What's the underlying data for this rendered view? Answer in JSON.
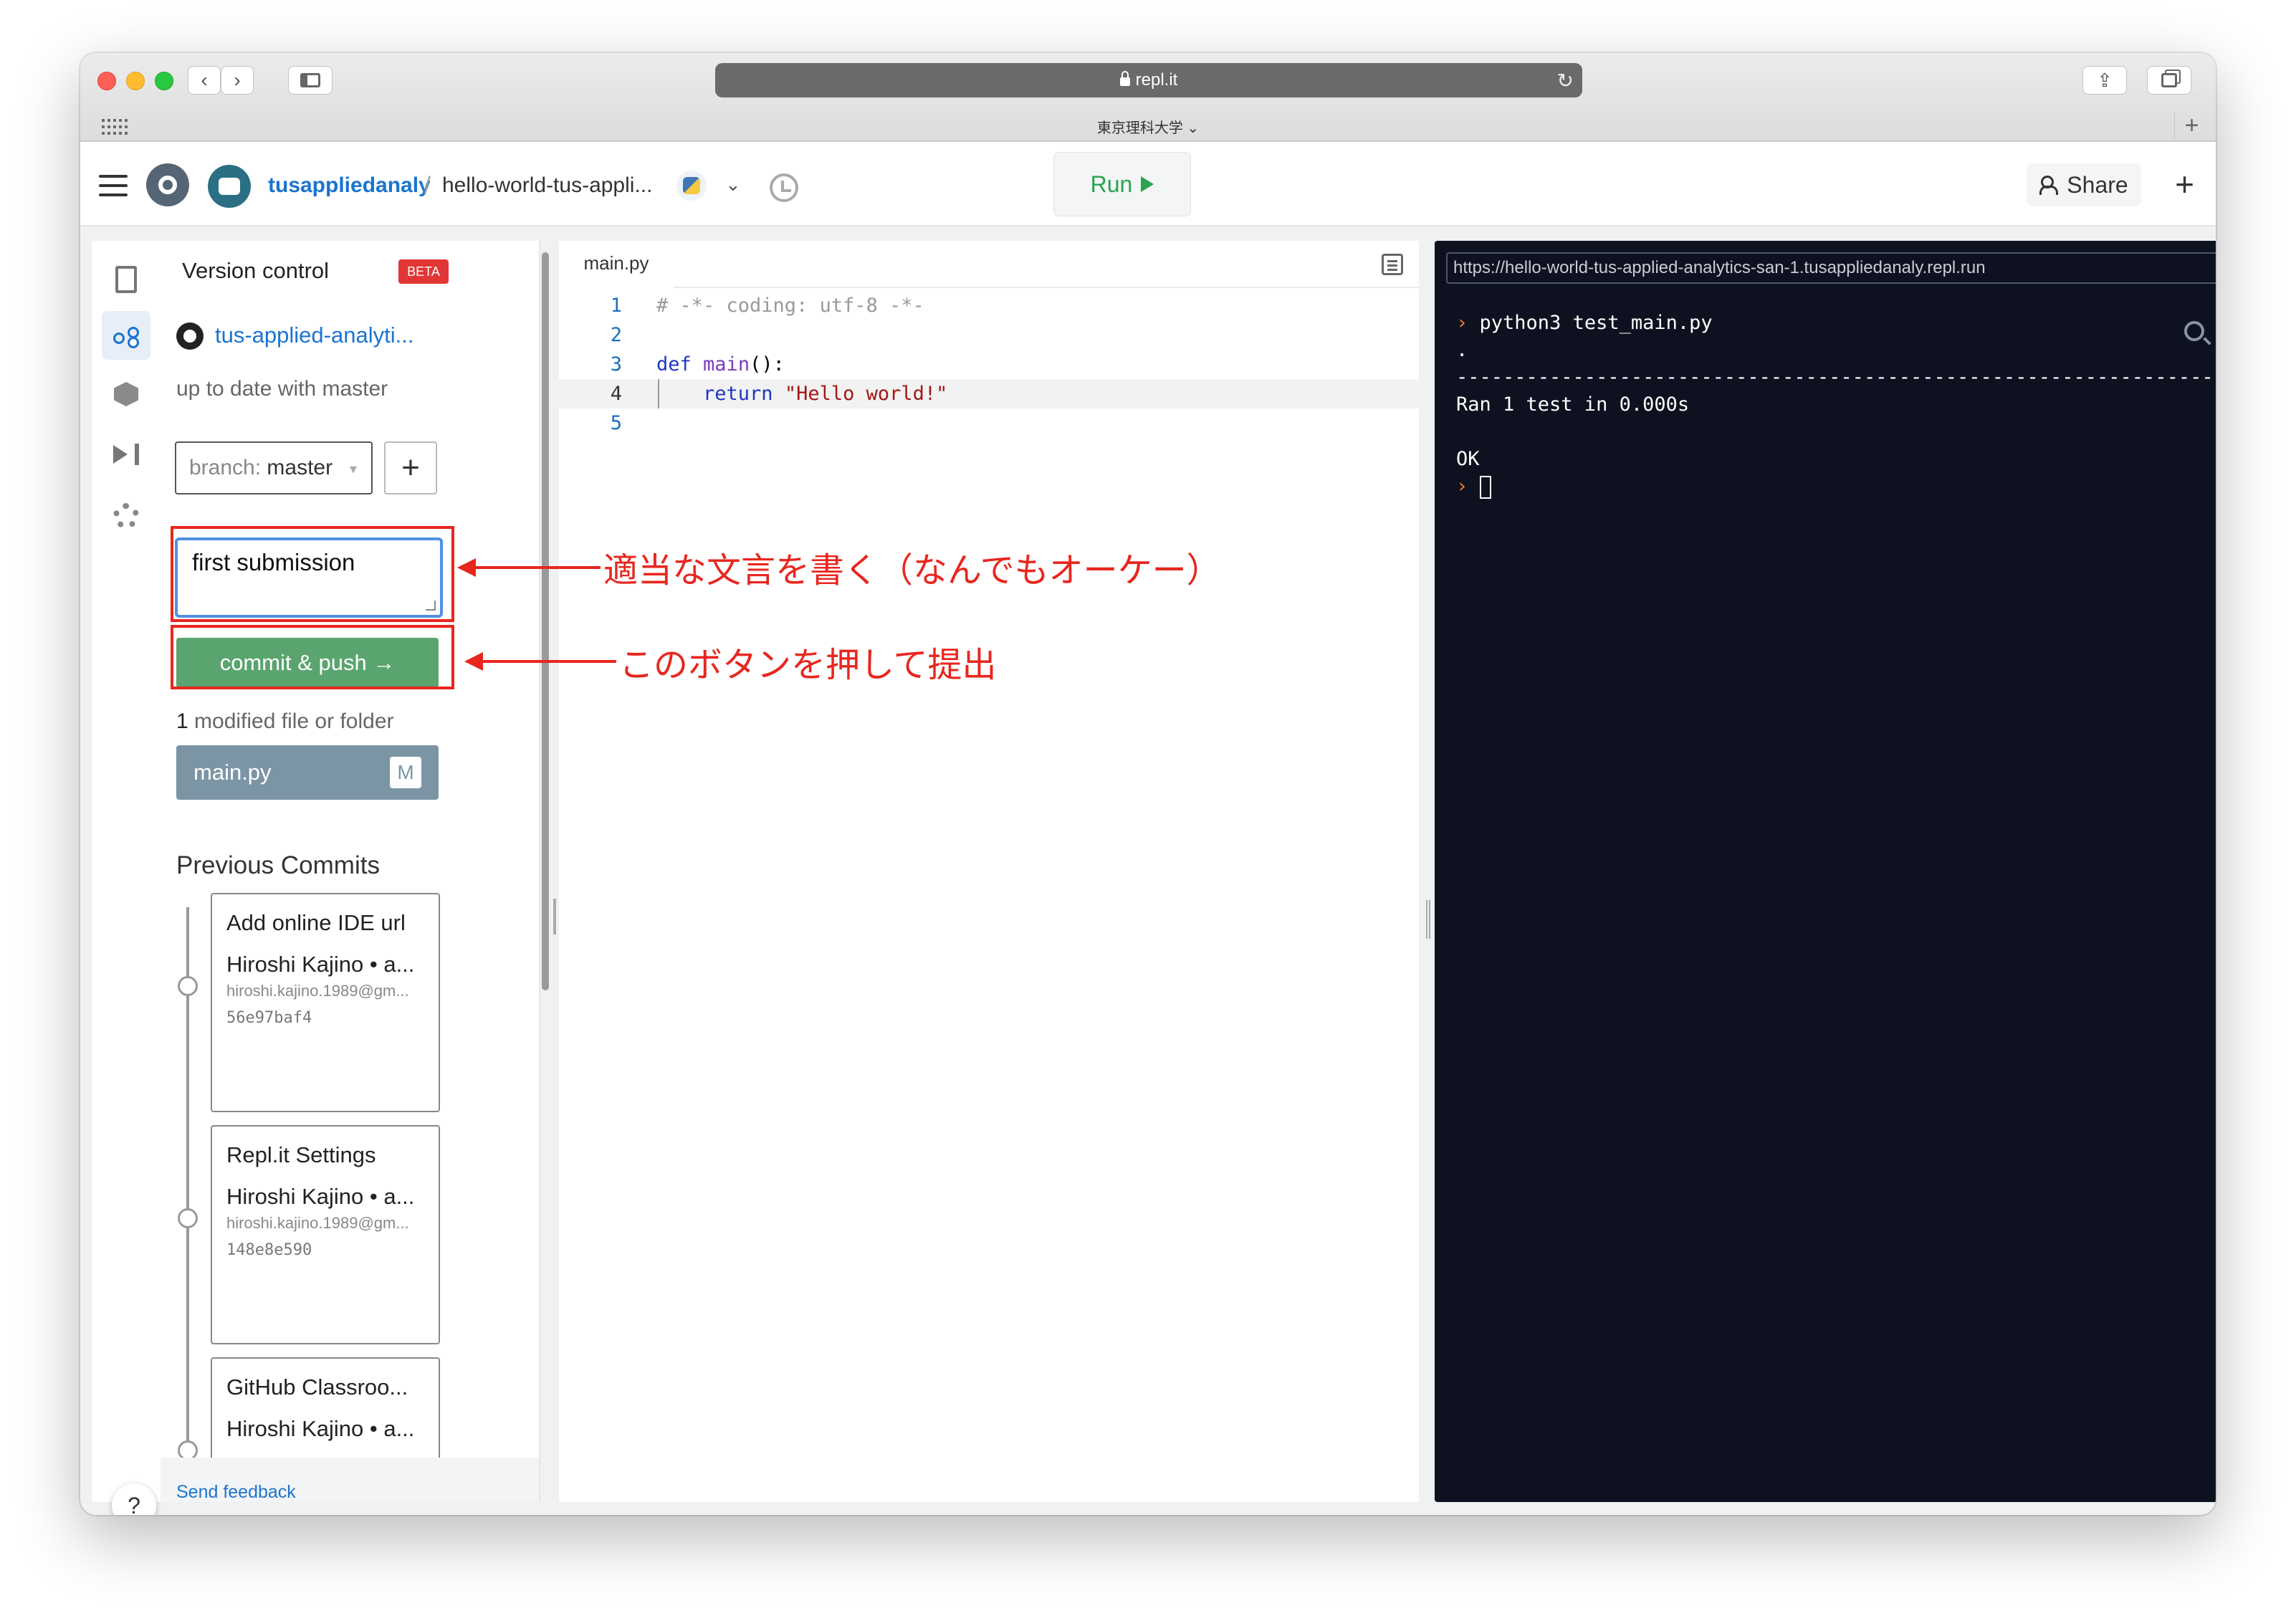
{
  "browser": {
    "url": "repl.it",
    "tab_title": "東京理科大学 ⌄"
  },
  "appbar": {
    "username": "tusappliedanaly",
    "separator": "/",
    "project": "hello-world-tus-appli...",
    "run_label": "Run",
    "share_label": "Share",
    "add_label": "+"
  },
  "version_control": {
    "title": "Version control",
    "beta": "BETA",
    "repo": "tus-applied-analyti...",
    "status": "up to date with master",
    "branch_label": "branch:",
    "branch_value": "master",
    "commit_message": "first submission",
    "commit_button": "commit & push →",
    "modified_count": "1",
    "modified_text": " modified file or folder",
    "modified_file": "main.py",
    "modified_badge": "M",
    "previous_title": "Previous Commits",
    "commits": [
      {
        "title": "Add online IDE url",
        "author": "Hiroshi Kajino • a...",
        "email": "hiroshi.kajino.1989@gm...",
        "hash": "56e97baf4"
      },
      {
        "title": "Repl.it Settings",
        "author": "Hiroshi Kajino • a...",
        "email": "hiroshi.kajino.1989@gm...",
        "hash": "148e8e590"
      },
      {
        "title": "GitHub Classroo...",
        "author": "Hiroshi Kajino • a...",
        "email": "",
        "hash": ""
      }
    ],
    "feedback": "Send feedback",
    "help": "?"
  },
  "editor": {
    "tab": "main.py",
    "lines": [
      {
        "n": "1",
        "comment": "# -*- coding: utf-8 -*-"
      },
      {
        "n": "2"
      },
      {
        "n": "3",
        "kw": "def",
        "fn": "main",
        "rest": "():"
      },
      {
        "n": "4",
        "kw": "return",
        "str": "\"Hello world!\""
      },
      {
        "n": "5"
      }
    ]
  },
  "console": {
    "url": "https://hello-world-tus-applied-analytics-san-1.tusappliedanaly.repl.run",
    "prompt": "›",
    "command": "python3 test_main.py",
    "dot": ".",
    "dashes": "----------------------------------------------------------------------",
    "ran": "Ran 1 test in 0.000s",
    "ok": "OK"
  },
  "annotations": {
    "message_note": "適当な文言を書く（なんでもオーケー）",
    "button_note": "このボタンを押して提出",
    "color": "#e8261e"
  }
}
